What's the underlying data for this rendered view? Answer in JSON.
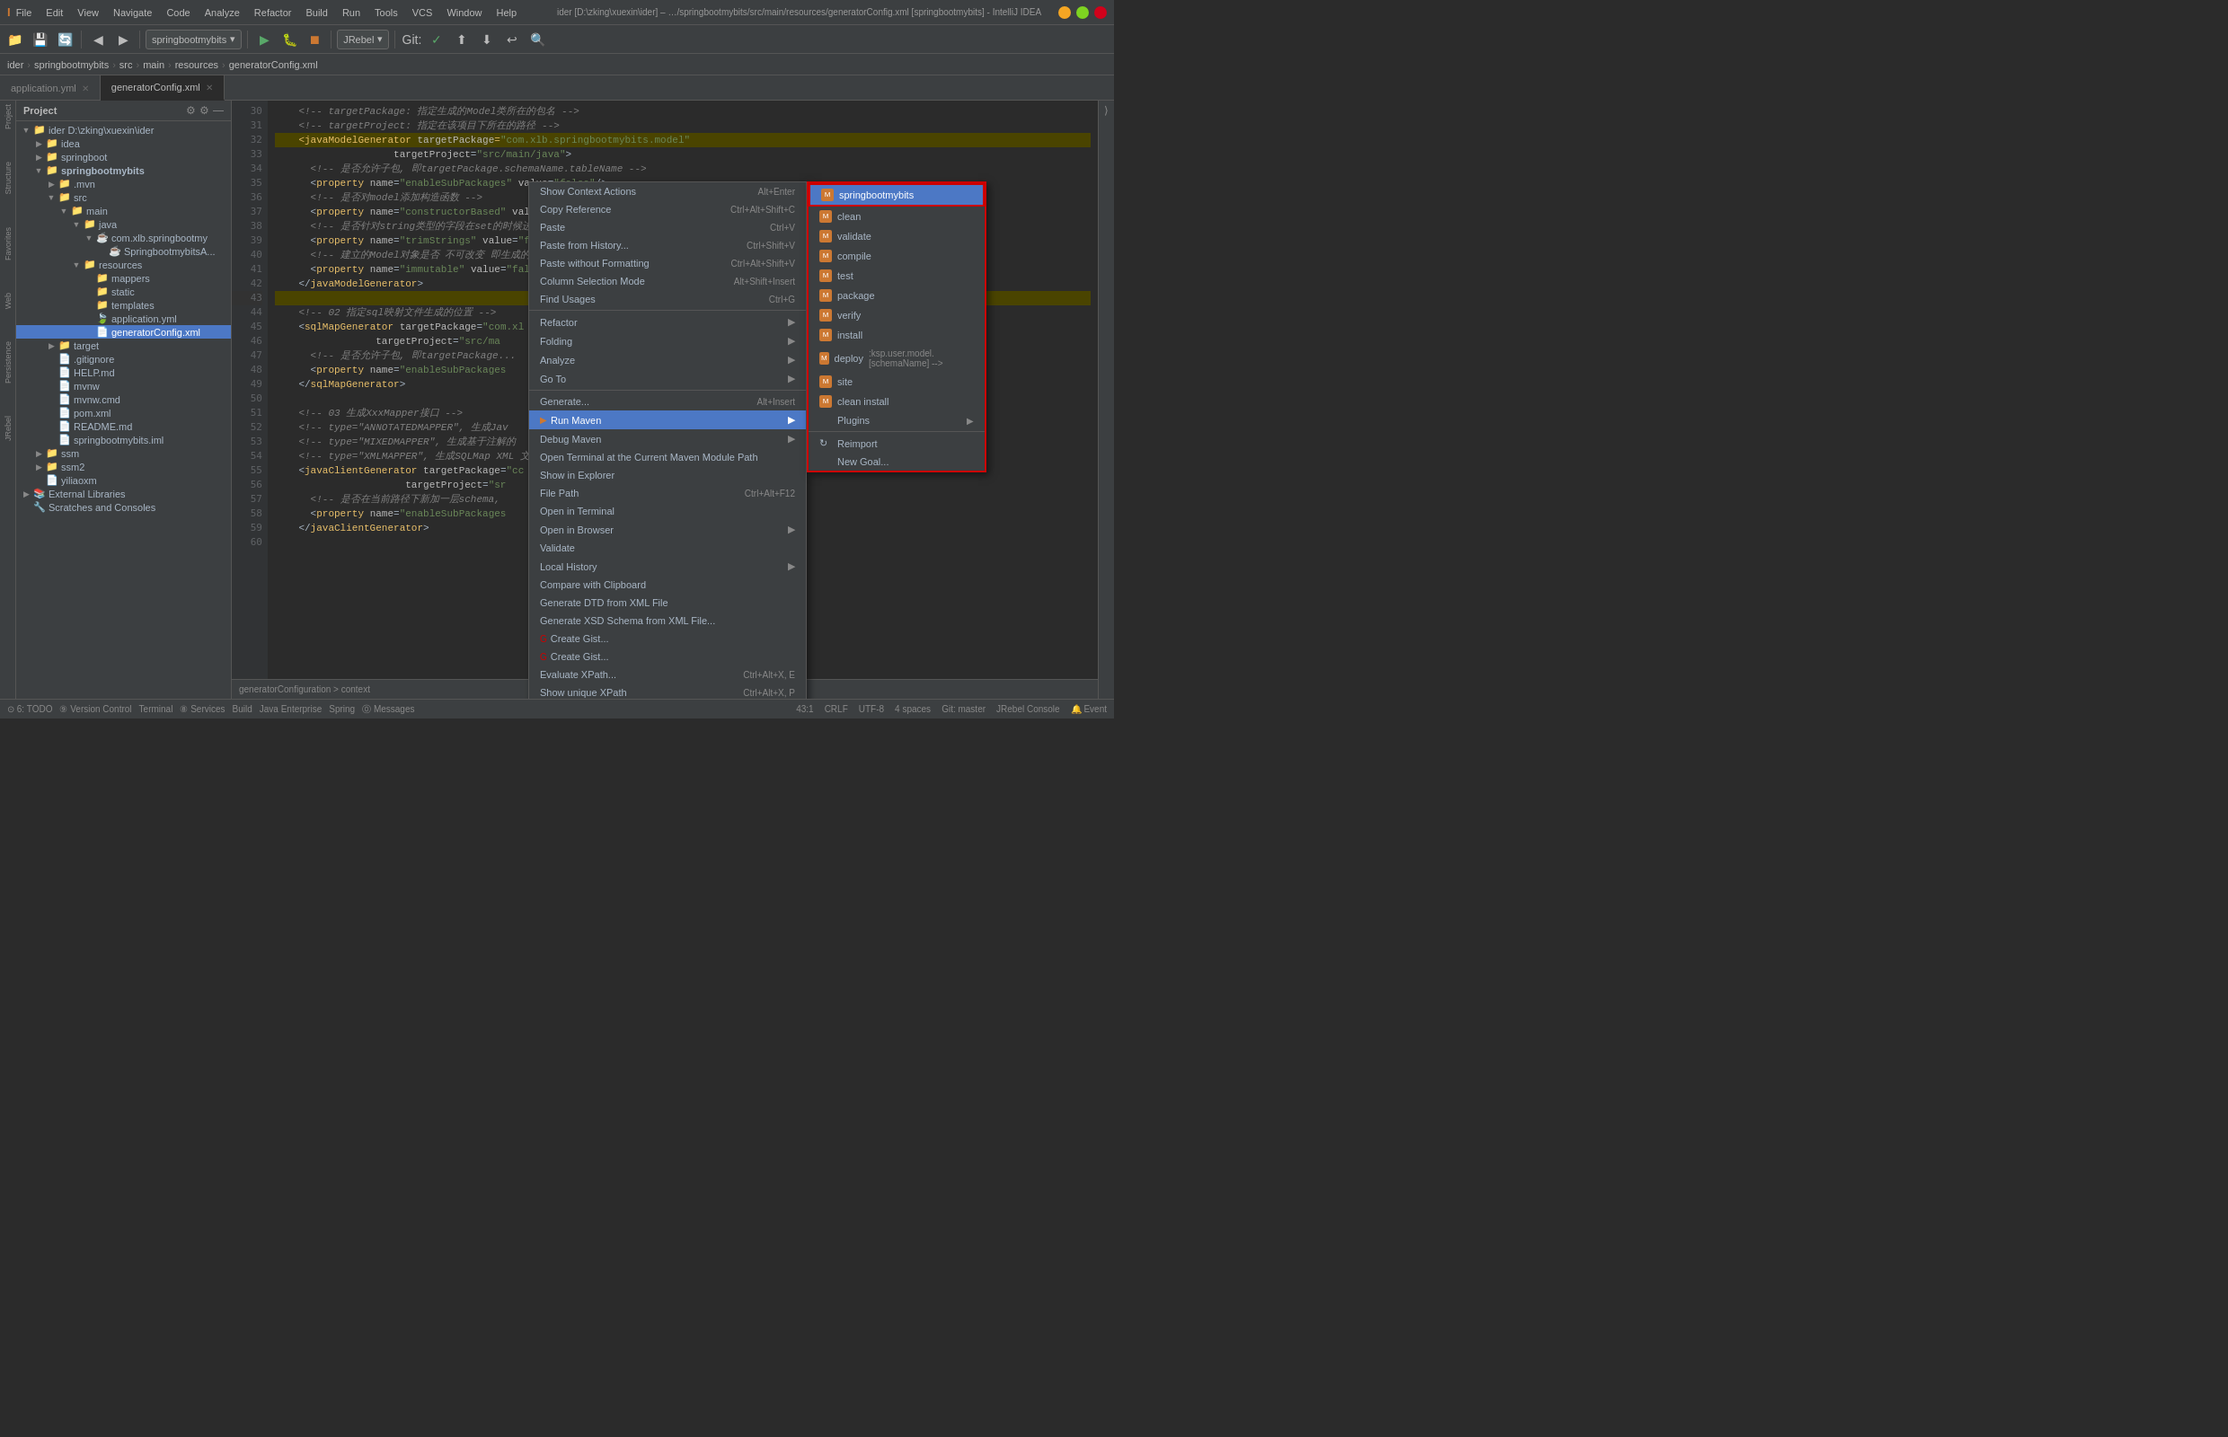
{
  "app": {
    "title": "ider [D:\\zking\\xuexin\\ider] – …/springbootmybits/src/main/resources/generatorConfig.xml [springbootmybits] - IntelliJ IDEA",
    "menus": [
      "File",
      "Edit",
      "View",
      "Navigate",
      "Code",
      "Analyze",
      "Refactor",
      "Build",
      "Run",
      "Tools",
      "VCS",
      "Window",
      "Help"
    ]
  },
  "toolbar": {
    "project_dropdown": "springbootmybits",
    "jrebel_dropdown": "JRebel"
  },
  "breadcrumb": {
    "items": [
      "ider",
      "springbootmybits",
      "src",
      "main",
      "resources",
      "generatorConfig.xml"
    ]
  },
  "tabs": [
    {
      "label": "application.yml",
      "active": false,
      "closable": true
    },
    {
      "label": "generatorConfig.xml",
      "active": true,
      "closable": true
    }
  ],
  "sidebar": {
    "title": "Project",
    "tree": [
      {
        "indent": 0,
        "arrow": "▼",
        "icon": "📁",
        "label": "ider D:\\zking\\xuexin\\ider",
        "type": "folder"
      },
      {
        "indent": 1,
        "arrow": "▶",
        "icon": "📁",
        "label": "idea",
        "type": "folder"
      },
      {
        "indent": 1,
        "arrow": "▼",
        "icon": "📁",
        "label": "springboot",
        "type": "folder"
      },
      {
        "indent": 1,
        "arrow": "▼",
        "icon": "📁",
        "label": "springbootmybits",
        "type": "folder",
        "bold": true
      },
      {
        "indent": 2,
        "arrow": "▶",
        "icon": "📁",
        "label": ".mvn",
        "type": "folder"
      },
      {
        "indent": 2,
        "arrow": "▼",
        "icon": "📁",
        "label": "src",
        "type": "folder"
      },
      {
        "indent": 3,
        "arrow": "▼",
        "icon": "📁",
        "label": "main",
        "type": "folder"
      },
      {
        "indent": 4,
        "arrow": "▼",
        "icon": "📁",
        "label": "java",
        "type": "folder"
      },
      {
        "indent": 5,
        "arrow": "▼",
        "icon": "☕",
        "label": "com.xlb.springbootmy",
        "type": "package"
      },
      {
        "indent": 6,
        "arrow": "",
        "icon": "☕",
        "label": "SpringbootmybitsA",
        "type": "java"
      },
      {
        "indent": 4,
        "arrow": "▼",
        "icon": "📁",
        "label": "resources",
        "type": "folder"
      },
      {
        "indent": 5,
        "arrow": "",
        "icon": "📁",
        "label": "mappers",
        "type": "folder"
      },
      {
        "indent": 5,
        "arrow": "",
        "icon": "📁",
        "label": "static",
        "type": "folder"
      },
      {
        "indent": 5,
        "arrow": "",
        "icon": "📁",
        "label": "templates",
        "type": "folder"
      },
      {
        "indent": 5,
        "arrow": "",
        "icon": "🍃",
        "label": "application.yml",
        "type": "file"
      },
      {
        "indent": 5,
        "arrow": "",
        "icon": "📄",
        "label": "generatorConfig.xml",
        "type": "file",
        "selected": true
      },
      {
        "indent": 2,
        "arrow": "▶",
        "icon": "📁",
        "label": "target",
        "type": "folder"
      },
      {
        "indent": 2,
        "arrow": "",
        "icon": "📄",
        "label": ".gitignore",
        "type": "file"
      },
      {
        "indent": 2,
        "arrow": "",
        "icon": "📄",
        "label": "HELP.md",
        "type": "file"
      },
      {
        "indent": 2,
        "arrow": "",
        "icon": "📄",
        "label": "mvnw",
        "type": "file"
      },
      {
        "indent": 2,
        "arrow": "",
        "icon": "📄",
        "label": "mvnw.cmd",
        "type": "file"
      },
      {
        "indent": 2,
        "arrow": "",
        "icon": "📄",
        "label": "pom.xml",
        "type": "file"
      },
      {
        "indent": 2,
        "arrow": "",
        "icon": "📄",
        "label": "README.md",
        "type": "file"
      },
      {
        "indent": 2,
        "arrow": "",
        "icon": "📄",
        "label": "springbootmybits.iml",
        "type": "file"
      },
      {
        "indent": 1,
        "arrow": "▶",
        "icon": "📁",
        "label": "ssm",
        "type": "folder"
      },
      {
        "indent": 1,
        "arrow": "▶",
        "icon": "📁",
        "label": "ssm2",
        "type": "folder"
      },
      {
        "indent": 1,
        "arrow": "",
        "icon": "📄",
        "label": "yiliaoxm",
        "type": "file"
      },
      {
        "indent": 0,
        "arrow": "▶",
        "icon": "📚",
        "label": "External Libraries",
        "type": "folder"
      },
      {
        "indent": 0,
        "arrow": "",
        "icon": "🔧",
        "label": "Scratches and Consoles",
        "type": "special"
      }
    ]
  },
  "code": {
    "lines": [
      {
        "num": 30,
        "content": "<!-- targetPackage: 指定生成的Model类所在的包名 -->"
      },
      {
        "num": 31,
        "content": "<!-- targetProject: 指定在该项目下所在的路径 -->"
      },
      {
        "num": 32,
        "content": "<javaModelGenerator targetPackage=\"com.xlb.springbootmybits.model\"",
        "highlight": true
      },
      {
        "num": 33,
        "content": "                    targetProject=\"src/main/java\">"
      },
      {
        "num": 34,
        "content": "  <!-- 是否允许子包, 即targetPackage.schemaName.tableName -->"
      },
      {
        "num": 35,
        "content": "  <property name=\"enableSubPackages\" value=\"false\"/>"
      },
      {
        "num": 36,
        "content": "  <!-- 是否对model添加构造函数 -->"
      },
      {
        "num": 37,
        "content": "  <property name=\"constructorBased\" value=\"true\"/>"
      },
      {
        "num": 38,
        "content": "  <!-- 是否针对string类型的字段在set的时候进行trim调用 -->"
      },
      {
        "num": 39,
        "content": "  <property name=\"trimStrings\" value=\"false\"/>"
      },
      {
        "num": 40,
        "content": "  <!-- 建立的Model对象是否 不可改变 即生成的Model对象不会有 setter方法, 只有构造方法 -->"
      },
      {
        "num": 41,
        "content": "  <property name=\"immutable\" value=\"false\"/>"
      },
      {
        "num": 42,
        "content": "</javaModelGenerator>"
      },
      {
        "num": 43,
        "content": "",
        "highlight": true
      },
      {
        "num": 44,
        "content": "<!-- 02 指定sql映射文件生成的位置 -->"
      },
      {
        "num": 45,
        "content": "<sqlMapGenerator targetPackage=\"com.xl"
      },
      {
        "num": 46,
        "content": "                 targetProject=\"src/ma"
      },
      {
        "num": 47,
        "content": "  <!-- 是否允许子包, 即targetPackage..."
      },
      {
        "num": 48,
        "content": "  <property name=\"enableSubPackages"
      },
      {
        "num": 49,
        "content": "</sqlMapGenerator>"
      },
      {
        "num": 50,
        "content": ""
      },
      {
        "num": 51,
        "content": "<!-- 03 生成XxxMapper接口 -->"
      },
      {
        "num": 52,
        "content": "<!-- type=\"ANNOTATEDMAPPER\", 生成Jav"
      },
      {
        "num": 53,
        "content": "<!-- type=\"MIXEDMAPPER\", 生成基于注解的"
      },
      {
        "num": 54,
        "content": "<!-- type=\"XMLMAPPER\", 生成SQLMap XML 文..."
      },
      {
        "num": 55,
        "content": "<javaClientGenerator targetPackage=\"cc"
      },
      {
        "num": 56,
        "content": "                      targetProject=\"sr"
      },
      {
        "num": 57,
        "content": "  <!-- 是否在当前路径下新加一层schema,"
      },
      {
        "num": 58,
        "content": "  <property name=\"enableSubPackages"
      },
      {
        "num": 59,
        "content": "</javaClientGenerator>"
      },
      {
        "num": 60,
        "content": ""
      }
    ]
  },
  "context_menu": {
    "items": [
      {
        "label": "Show Context Actions",
        "shortcut": "Alt+Enter",
        "type": "normal"
      },
      {
        "label": "Copy Reference",
        "shortcut": "Ctrl+Alt+Shift+C",
        "type": "normal"
      },
      {
        "label": "Paste",
        "shortcut": "Ctrl+V",
        "type": "normal"
      },
      {
        "label": "Paste from History...",
        "shortcut": "Ctrl+Shift+V",
        "type": "normal"
      },
      {
        "label": "Paste without Formatting",
        "shortcut": "Ctrl+Alt+Shift+V",
        "type": "normal"
      },
      {
        "label": "Column Selection Mode",
        "shortcut": "Alt+Shift+Insert",
        "type": "normal"
      },
      {
        "label": "Find Usages",
        "shortcut": "Ctrl+G",
        "type": "normal"
      },
      {
        "label": "Refactor",
        "shortcut": "",
        "type": "arrow",
        "sep_before": false
      },
      {
        "label": "Folding",
        "shortcut": "",
        "type": "arrow"
      },
      {
        "label": "Analyze",
        "shortcut": "",
        "type": "arrow"
      },
      {
        "label": "Go To",
        "shortcut": "",
        "type": "arrow",
        "sep_after": true
      },
      {
        "label": "Generate...",
        "shortcut": "Alt+Insert",
        "type": "normal",
        "sep_before": true
      },
      {
        "label": "Run Maven",
        "shortcut": "",
        "type": "arrow",
        "active": true
      },
      {
        "label": "Debug Maven",
        "shortcut": "",
        "type": "arrow"
      },
      {
        "label": "Open Terminal at the Current Maven Module Path",
        "shortcut": "",
        "type": "normal"
      },
      {
        "label": "Show in Explorer",
        "shortcut": "",
        "type": "normal"
      },
      {
        "label": "File Path",
        "shortcut": "Ctrl+Alt+F12",
        "type": "normal"
      },
      {
        "label": "Open in Terminal",
        "shortcut": "",
        "type": "normal"
      },
      {
        "label": "Open in Browser",
        "shortcut": "",
        "type": "arrow"
      },
      {
        "label": "Validate",
        "shortcut": "",
        "type": "normal"
      },
      {
        "label": "Local History",
        "shortcut": "",
        "type": "arrow"
      },
      {
        "label": "Compare with Clipboard",
        "shortcut": "",
        "type": "normal"
      },
      {
        "label": "Generate DTD from XML File",
        "shortcut": "",
        "type": "normal"
      },
      {
        "label": "Generate XSD Schema from XML File...",
        "shortcut": "",
        "type": "normal"
      },
      {
        "label": "Create Gist...",
        "shortcut": "",
        "type": "normal"
      },
      {
        "label": "Create Gist...",
        "shortcut": "",
        "type": "normal"
      },
      {
        "label": "Evaluate XPath...",
        "shortcut": "Ctrl+Alt+X, E",
        "type": "normal"
      },
      {
        "label": "Show unique XPath",
        "shortcut": "Ctrl+Alt+X, P",
        "type": "normal"
      }
    ]
  },
  "run_maven_submenu": {
    "title": "springbootmybits",
    "items": [
      {
        "label": "springbootmybits",
        "type": "project",
        "first": true
      },
      {
        "label": "clean",
        "type": "maven"
      },
      {
        "label": "validate",
        "type": "maven"
      },
      {
        "label": "compile",
        "type": "maven"
      },
      {
        "label": "test",
        "type": "maven"
      },
      {
        "label": "package",
        "type": "maven"
      },
      {
        "label": "verify",
        "type": "maven"
      },
      {
        "label": "install",
        "type": "maven"
      },
      {
        "label": "deploy",
        "type": "maven"
      },
      {
        "label": "site",
        "type": "maven"
      },
      {
        "label": "clean install",
        "type": "maven"
      },
      {
        "label": "Plugins",
        "type": "arrow"
      },
      {
        "label": "Reimport",
        "type": "normal"
      },
      {
        "label": "New Goal...",
        "type": "normal"
      }
    ]
  },
  "status_bar": {
    "left_items": [
      "6: TODO",
      "9: Version Control",
      "Terminal",
      "8: Services",
      "Build",
      "Java Enterprise",
      "Spring",
      "0: Messages"
    ],
    "right_items": [
      "43:1",
      "CRLF",
      "UTF-8",
      "4 spaces",
      "Git: master"
    ],
    "bottom_nav": "generatorConfiguration > context"
  },
  "colors": {
    "accent": "#4c78c5",
    "active_menu": "#4c78c5",
    "border": "#555555",
    "bg_dark": "#2b2b2b",
    "bg_medium": "#3c3f41",
    "text_primary": "#a9b7c6",
    "keyword": "#cc7832",
    "string": "#6a8759",
    "comment": "#808080",
    "highlight_border": "#cc0000"
  }
}
